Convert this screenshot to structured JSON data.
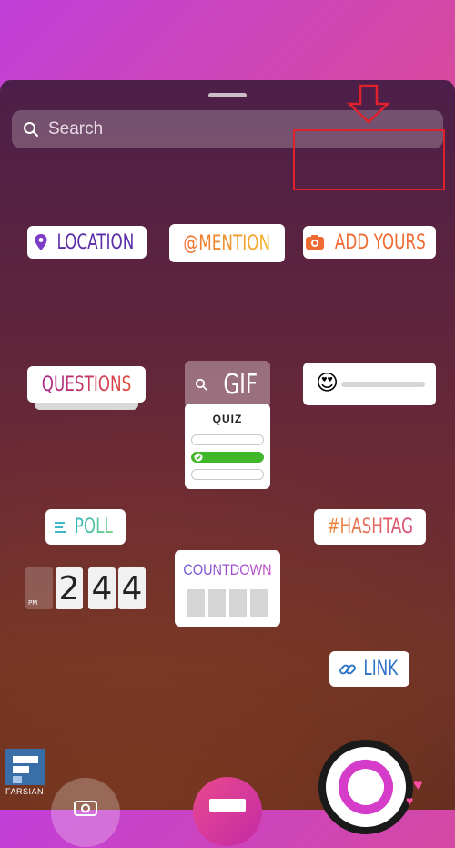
{
  "search": {
    "placeholder": "Search"
  },
  "stickers": {
    "location": "LOCATION",
    "mention": "@MENTION",
    "add_yours": "ADD YOURS",
    "questions": "QUESTIONS",
    "gif": "GIF",
    "poll": "POLL",
    "quiz_title": "QUIZ",
    "hashtag": "#HASHTAG",
    "clock_digits": [
      "2",
      "4",
      "4"
    ],
    "clock_ampm": "PM",
    "countdown": "COUNTDOWN",
    "link": "LINK",
    "emoji_slider": "😍"
  },
  "watermark": {
    "label": "FARSIAN"
  },
  "colors": {
    "location": "#5a2ea6",
    "add_yours": "#ee6b34",
    "questions": "#c03065",
    "poll": "#2fb5c7",
    "hashtag": "#e7824b",
    "link": "#2f74c8",
    "highlight": "#e0202a"
  }
}
